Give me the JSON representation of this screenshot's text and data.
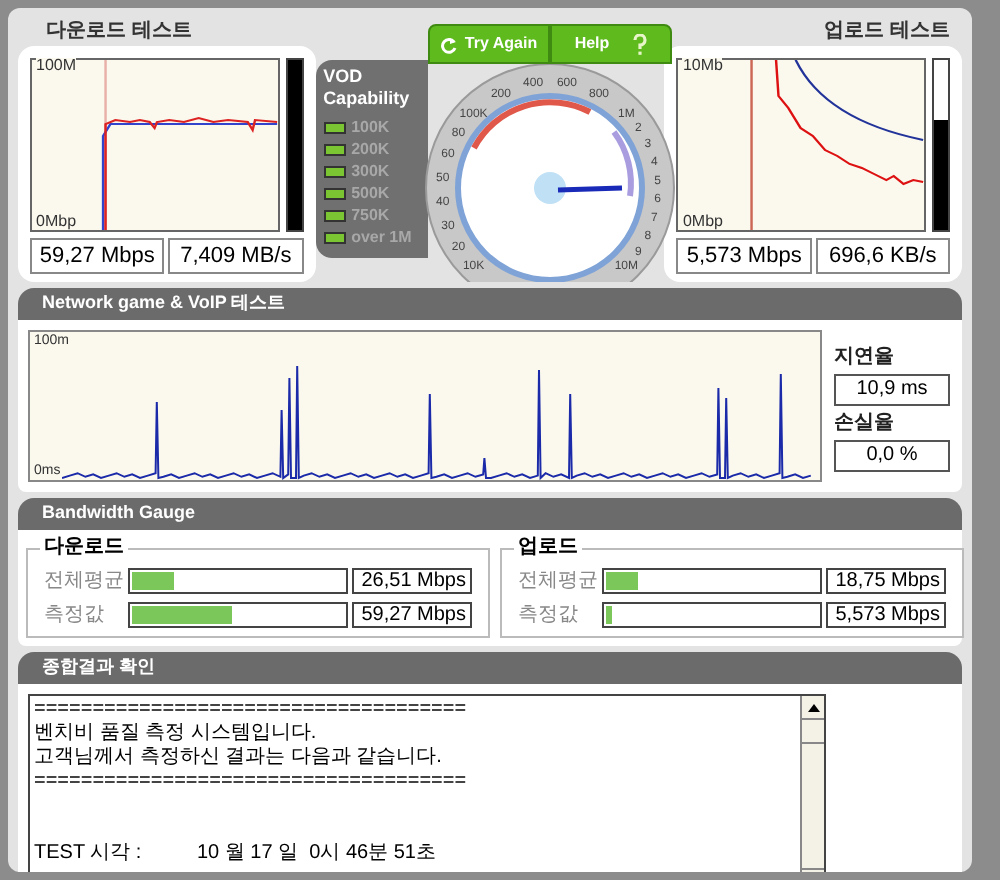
{
  "download_test": {
    "title": "다운로드 테스트",
    "axis_labels": [
      "100M",
      "0Mbp"
    ],
    "meter": {
      "level": 1
    },
    "readings": [
      "59,27 Mbps",
      "7,409 MB/s"
    ]
  },
  "vod_capability": {
    "title": "VOD Capability",
    "items": [
      {
        "label": "100K",
        "on": true
      },
      {
        "label": "200K",
        "on": true
      },
      {
        "label": "300K",
        "on": true
      },
      {
        "label": "500K",
        "on": true
      },
      {
        "label": "750K",
        "on": true
      },
      {
        "label": "over 1M",
        "on": true
      }
    ]
  },
  "buttons": [
    {
      "label": "Try Again",
      "kind": "retry"
    },
    {
      "label": "Help",
      "kind": "help"
    }
  ],
  "speed_dial": {
    "labels": [
      "400",
      "600",
      "200",
      "800",
      "100K",
      "1M",
      "2",
      "80",
      "3",
      "60",
      "4",
      "50",
      "5",
      "6",
      "40",
      "7",
      "30",
      "8",
      "20",
      "9",
      "10K",
      "10M"
    ]
  },
  "upload_test": {
    "title": "업로드 테스트",
    "axis_labels": [
      "10Mb",
      "0Mbp"
    ],
    "meter": {
      "level": 0.65
    },
    "readings": [
      "5,573 Mbps",
      "696,6 KB/s"
    ]
  },
  "network_test": {
    "title": "Network game & VoIP 테스트",
    "axis_labels": [
      "100m",
      "0ms"
    ],
    "latency_label": "지연율",
    "latency": "10,9 ms",
    "loss_label": "손실율",
    "loss": "0,0 %"
  },
  "bandwidth_gauge": {
    "title": "Bandwidth Gauge",
    "groups": [
      {
        "title": "다운로드",
        "rows": [
          {
            "label": "전체평균",
            "level": 0.2,
            "value": "26,51 Mbps"
          },
          {
            "label": "측정값",
            "level": 0.47,
            "value": "59,27 Mbps"
          }
        ]
      },
      {
        "title": "업로드",
        "rows": [
          {
            "label": "전체평균",
            "level": 0.15,
            "value": "18,75 Mbps"
          },
          {
            "label": "측정값",
            "level": 0.03,
            "value": "5,573 Mbps"
          }
        ]
      }
    ]
  },
  "summary": {
    "title": "종합결과 확인",
    "text": "=====================================\n벤치비 품질 측정 시스템입니다.\n고객님께서 측정하신 결과는 다음과 같습니다.\n=====================================\n\n\nTEST 시각 :          10 월 17 일  0시 46분 51초"
  }
}
